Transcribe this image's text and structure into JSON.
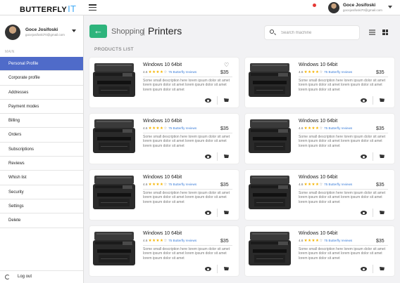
{
  "app": {
    "logo_main": "BUTTERFLY",
    "logo_accent": "IT"
  },
  "user": {
    "name": "Goce Josifoski",
    "email": "gocejosifoski70@gmail.com"
  },
  "sidebar": {
    "section_label": "MAIN",
    "items": [
      {
        "label": "Personal Profile",
        "active": true
      },
      {
        "label": "Corporate profile"
      },
      {
        "label": "Addresses"
      },
      {
        "label": "Payment modes"
      },
      {
        "label": "Billing"
      },
      {
        "label": "Orders"
      },
      {
        "label": "Subscriptions"
      },
      {
        "label": "Reviews"
      },
      {
        "label": "Whish list"
      },
      {
        "label": "Security"
      },
      {
        "label": "Settings"
      },
      {
        "label": "Delete"
      }
    ],
    "logout_label": "Log out"
  },
  "header": {
    "breadcrumb_parent": "Shopping",
    "breadcrumb_separator": "|",
    "page_title": "Printers",
    "search_placeholder": "Search machine",
    "back_icon": "arrow-left-icon"
  },
  "products_label": "PRODUCTS LIST",
  "accent_color": "#2eb47c",
  "active_menu_color": "#4f6bc9",
  "products": [
    {
      "title": "Windows 10 64bit",
      "rating_value": "4.6",
      "rating": 4,
      "reviews": "75 Butterfly reviews",
      "price": "$35",
      "description": "Some small description here lorem ipsum dolor sit amet lorem ipsum dolor sit amet lorem ipsum dolor sit amet lorem ipsum dolor sit amet",
      "wishlist": true
    },
    {
      "title": "Windows 10 64bit",
      "rating_value": "4.6",
      "rating": 4,
      "reviews": "75 Butterfly reviews",
      "price": "$35",
      "description": "Some small description here lorem ipsum dolor sit amet lorem ipsum dolor sit amet lorem ipsum dolor sit amet lorem ipsum dolor sit amet",
      "wishlist": false
    },
    {
      "title": "Windows 10 64bit",
      "rating_value": "4.6",
      "rating": 4,
      "reviews": "75 Butterfly reviews",
      "price": "$35",
      "description": "Some small description here lorem ipsum dolor sit amet lorem ipsum dolor sit amet lorem ipsum dolor sit amet lorem ipsum dolor sit amet",
      "wishlist": false
    },
    {
      "title": "Windows 10 64bit",
      "rating_value": "4.6",
      "rating": 4,
      "reviews": "75 Butterfly reviews",
      "price": "$35",
      "description": "Some small description here lorem ipsum dolor sit amet lorem ipsum dolor sit amet lorem ipsum dolor sit amet lorem ipsum dolor sit amet",
      "wishlist": false
    },
    {
      "title": "Windows 10 64bit",
      "rating_value": "4.6",
      "rating": 4,
      "reviews": "75 Butterfly reviews",
      "price": "$35",
      "description": "Some small description here lorem ipsum dolor sit amet lorem ipsum dolor sit amet lorem ipsum dolor sit amet lorem ipsum dolor sit amet",
      "wishlist": false
    },
    {
      "title": "Windows 10 64bit",
      "rating_value": "4.6",
      "rating": 4,
      "reviews": "75 Butterfly reviews",
      "price": "$35",
      "description": "Some small description here lorem ipsum dolor sit amet lorem ipsum dolor sit amet lorem ipsum dolor sit amet lorem ipsum dolor sit amet",
      "wishlist": false
    },
    {
      "title": "Windows 10 64bit",
      "rating_value": "4.6",
      "rating": 4,
      "reviews": "75 Butterfly reviews",
      "price": "$35",
      "description": "Some small description here lorem ipsum dolor sit amet lorem ipsum dolor sit amet lorem ipsum dolor sit amet lorem ipsum dolor sit amet",
      "wishlist": false
    },
    {
      "title": "Windows 10 64bit",
      "rating_value": "4.6",
      "rating": 4,
      "reviews": "75 Butterfly reviews",
      "price": "$35",
      "description": "Some small description here lorem ipsum dolor sit amet lorem ipsum dolor sit amet lorem ipsum dolor sit amet lorem ipsum dolor sit amet",
      "wishlist": false
    }
  ]
}
